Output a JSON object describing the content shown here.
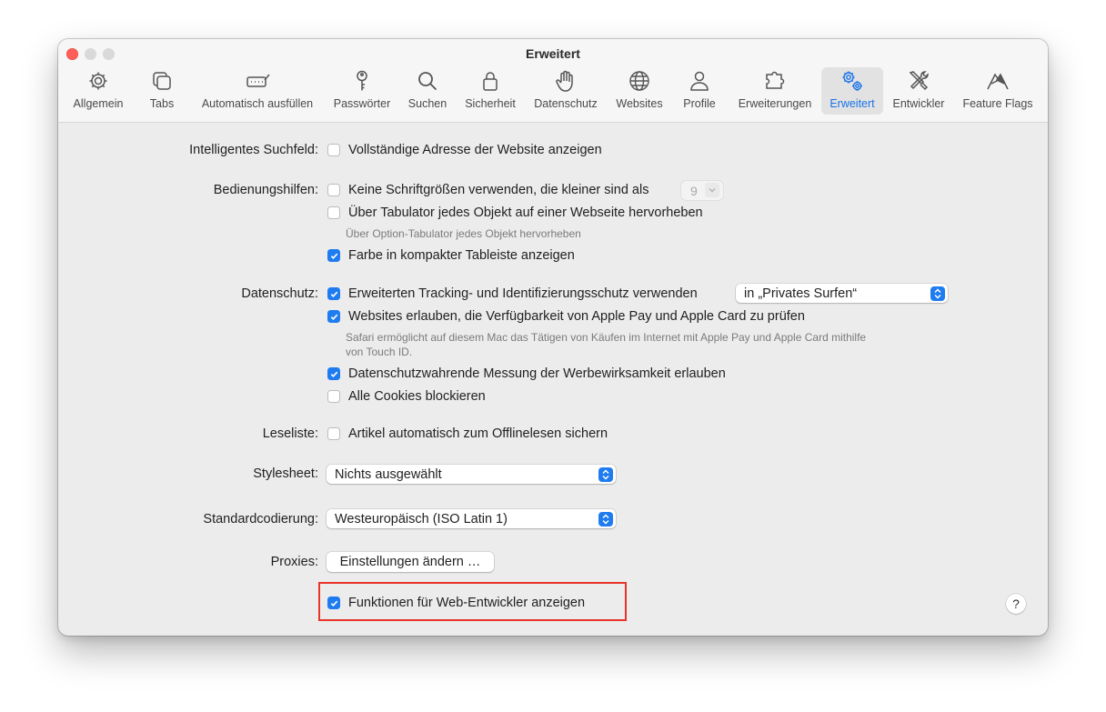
{
  "window": {
    "title": "Erweitert"
  },
  "tabs": [
    {
      "label": "Allgemein",
      "icon": "gear-icon"
    },
    {
      "label": "Tabs",
      "icon": "tabs-icon"
    },
    {
      "label": "Automatisch ausfüllen",
      "icon": "autofill-icon"
    },
    {
      "label": "Passwörter",
      "icon": "key-icon"
    },
    {
      "label": "Suchen",
      "icon": "search-icon"
    },
    {
      "label": "Sicherheit",
      "icon": "lock-icon"
    },
    {
      "label": "Datenschutz",
      "icon": "hand-icon"
    },
    {
      "label": "Websites",
      "icon": "globe-icon"
    },
    {
      "label": "Profile",
      "icon": "person-icon"
    },
    {
      "label": "Erweiterungen",
      "icon": "puzzle-icon"
    },
    {
      "label": "Erweitert",
      "icon": "gears-icon",
      "active": true
    },
    {
      "label": "Entwickler",
      "icon": "tools-icon"
    },
    {
      "label": "Feature Flags",
      "icon": "flags-icon"
    }
  ],
  "settings": {
    "smart_search": {
      "label": "Intelligentes Suchfeld:",
      "full_address": {
        "label": "Vollständige Adresse der Website anzeigen",
        "checked": false
      }
    },
    "accessibility": {
      "label": "Bedienungshilfen:",
      "min_font": {
        "label": "Keine Schriftgrößen verwenden, die kleiner sind als",
        "checked": false,
        "value": "9"
      },
      "tab_highlight": {
        "label": "Über Tabulator jedes Objekt auf einer Webseite hervorheben",
        "checked": false
      },
      "tab_hint": "Über Option-Tabulator jedes Objekt hervorheben",
      "compact_color": {
        "label": "Farbe in kompakter Tableiste anzeigen",
        "checked": true
      }
    },
    "privacy": {
      "label": "Datenschutz:",
      "tracking": {
        "label": "Erweiterten Tracking- und Identifizierungsschutz verwenden",
        "checked": true,
        "popup": "in „Privates Surfen“"
      },
      "apple_pay": {
        "label": "Websites erlauben, die Verfügbarkeit von Apple Pay und Apple Card zu prüfen",
        "checked": true
      },
      "apple_pay_hint_1": "Safari ermöglicht auf diesem Mac das Tätigen von Käufen im Internet mit Apple Pay und Apple Card mithilfe",
      "apple_pay_hint_2": "von Touch ID.",
      "ad_measurement": {
        "label": "Datenschutzwahrende Messung der Werbewirksamkeit erlauben",
        "checked": true
      },
      "block_cookies": {
        "label": "Alle Cookies blockieren",
        "checked": false
      }
    },
    "reading_list": {
      "label": "Leseliste:",
      "offline": {
        "label": "Artikel automatisch zum Offlinelesen sichern",
        "checked": false
      }
    },
    "stylesheet": {
      "label": "Stylesheet:",
      "value": "Nichts ausgewählt"
    },
    "encoding": {
      "label": "Standardcodierung:",
      "value": "Westeuropäisch (ISO Latin 1)"
    },
    "proxies": {
      "label": "Proxies:",
      "button": "Einstellungen ändern …"
    },
    "developer": {
      "label": "Funktionen für Web-Entwickler anzeigen",
      "checked": true
    }
  },
  "help": "?",
  "colors": {
    "accent": "#1f7cf0",
    "highlight_box": "#e8342a",
    "close": "#ff5f57"
  }
}
